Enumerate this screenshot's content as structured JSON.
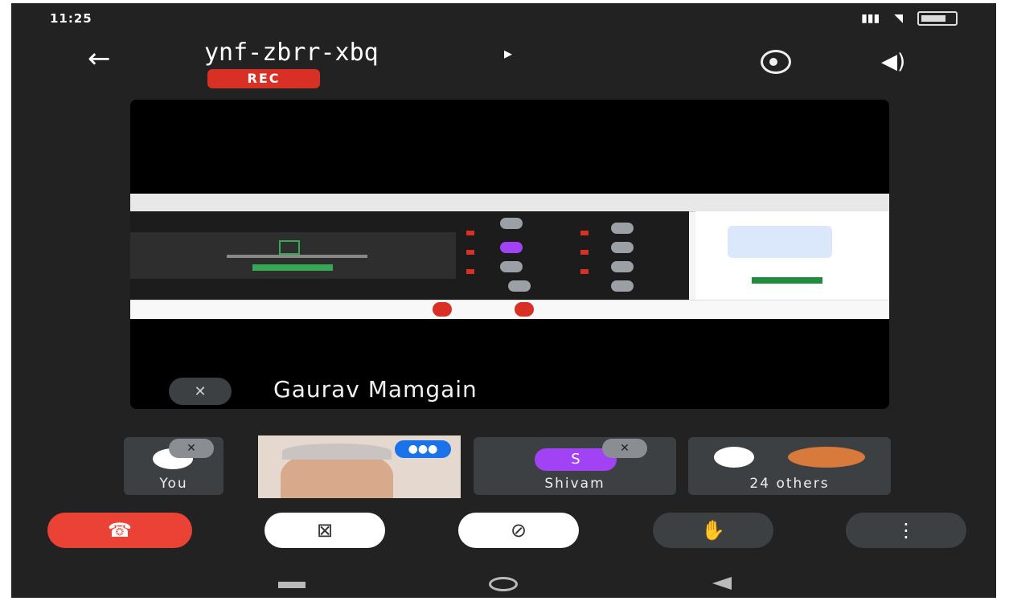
{
  "status_bar": {
    "time": "11:25",
    "icons": [
      "notification-icon",
      "signal-icon",
      "wifi-icon",
      "battery-icon"
    ]
  },
  "header": {
    "meeting_code": "ynf-zbrr-xbq",
    "caret": "▸",
    "rec_label": "REC"
  },
  "main": {
    "presenter_name": "Gaurav Mamgain",
    "presenter_muted": true
  },
  "participants": [
    {
      "label": "You",
      "muted": true
    },
    {
      "label": "",
      "speaking": true
    },
    {
      "label": "Shivam",
      "avatar_letter": "S",
      "muted": true
    },
    {
      "label": "24 others"
    }
  ],
  "controls": {
    "end_call_icon": "☎",
    "camera_icon": "⊠",
    "mic_icon": "⊘",
    "raise_hand_icon": "✋",
    "more_icon": "⋮"
  },
  "colors": {
    "background": "#222222",
    "rec": "#d93025",
    "end_call": "#ea4335",
    "speaking": "#1a73e8",
    "avatar_s": "#a142f4"
  }
}
